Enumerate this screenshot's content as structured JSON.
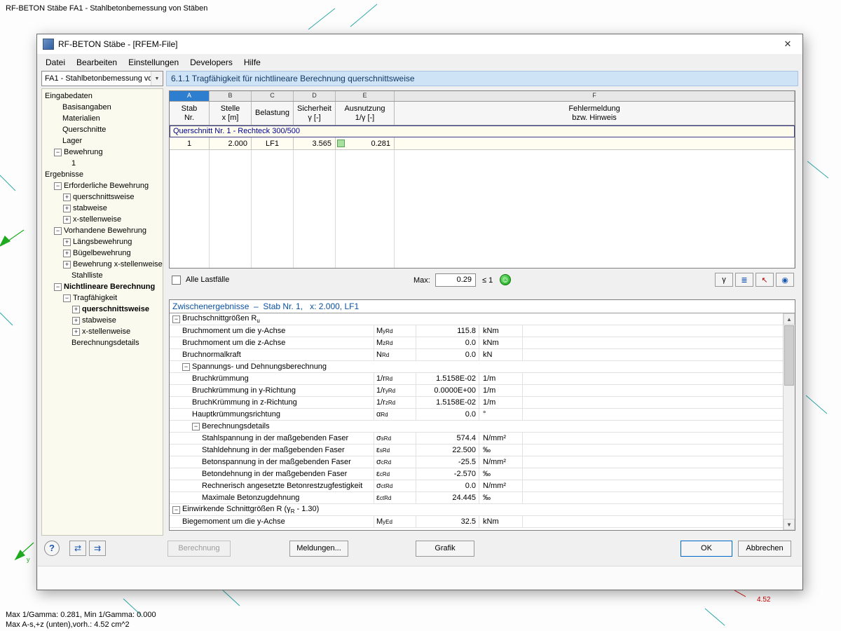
{
  "desktop": {
    "caption": "RF-BETON Stäbe FA1 - Stahlbetonbemessung von Stäben",
    "status1": "Max 1/Gamma: 0.281, Min 1/Gamma: 0.000",
    "status2": "Max A-s,+z (unten),vorh.: 4.52 cm^2",
    "annotation": "4.52",
    "axis_label": "y"
  },
  "dialog": {
    "title": "RF-BETON Stäbe - [RFEM-File]",
    "menu": [
      "Datei",
      "Bearbeiten",
      "Einstellungen",
      "Developers",
      "Hilfe"
    ],
    "nav_selector": "FA1 - Stahlbetonbemessung vo",
    "header": "6.1.1 Tragfähigkeit für nichtlineare Berechnung querschnittsweise"
  },
  "tree": {
    "items": [
      {
        "label": "Eingabedaten",
        "level": 0,
        "exp": "none"
      },
      {
        "label": "Basisangaben",
        "level": 1,
        "exp": "none"
      },
      {
        "label": "Materialien",
        "level": 1,
        "exp": "none"
      },
      {
        "label": "Querschnitte",
        "level": 1,
        "exp": "none"
      },
      {
        "label": "Lager",
        "level": 1,
        "exp": "none"
      },
      {
        "label": "Bewehrung",
        "level": 1,
        "exp": "minus"
      },
      {
        "label": "1",
        "level": 2,
        "exp": "none"
      },
      {
        "label": "Ergebnisse",
        "level": 0,
        "exp": "none"
      },
      {
        "label": "Erforderliche Bewehrung",
        "level": 1,
        "exp": "minus"
      },
      {
        "label": "querschnittsweise",
        "level": 2,
        "exp": "plus"
      },
      {
        "label": "stabweise",
        "level": 2,
        "exp": "plus"
      },
      {
        "label": "x-stellenweise",
        "level": 2,
        "exp": "plus"
      },
      {
        "label": "Vorhandene Bewehrung",
        "level": 1,
        "exp": "minus"
      },
      {
        "label": "Längsbewehrung",
        "level": 2,
        "exp": "plus"
      },
      {
        "label": "Bügelbewehrung",
        "level": 2,
        "exp": "plus"
      },
      {
        "label": "Bewehrung x-stellenweise",
        "level": 2,
        "exp": "plus"
      },
      {
        "label": "Stahlliste",
        "level": 2,
        "exp": "none"
      },
      {
        "label": "Nichtlineare Berechnung",
        "level": 1,
        "exp": "minus",
        "bold": true
      },
      {
        "label": "Tragfähigkeit",
        "level": 2,
        "exp": "minus"
      },
      {
        "label": "querschnittsweise",
        "level": 3,
        "exp": "plus",
        "bold": true,
        "selected": true
      },
      {
        "label": "stabweise",
        "level": 3,
        "exp": "plus"
      },
      {
        "label": "x-stellenweise",
        "level": 3,
        "exp": "plus"
      },
      {
        "label": "Berechnungsdetails",
        "level": 2,
        "exp": "none"
      }
    ]
  },
  "table": {
    "letters": [
      "A",
      "B",
      "C",
      "D",
      "E",
      "F"
    ],
    "selected_letter": "A",
    "headers": [
      {
        "l1": "Stab",
        "l2": "Nr."
      },
      {
        "l1": "Stelle",
        "l2": "x [m]"
      },
      {
        "l1": "Belastung",
        "l2": ""
      },
      {
        "l1": "Sicherheit",
        "l2": "γ [-]"
      },
      {
        "l1": "Ausnutzung",
        "l2": "1/γ [-]"
      },
      {
        "l1": "Fehlermeldung",
        "l2": "bzw. Hinweis"
      }
    ],
    "group_row": "Querschnitt Nr. 1 - Rechteck 300/500",
    "rows": [
      {
        "cells": [
          "1",
          "2.000",
          "LF1",
          "3.565",
          "0.281",
          ""
        ],
        "marker": true
      }
    ]
  },
  "filter": {
    "all_label": "Alle Lastfälle",
    "checked": false,
    "max_label": "Max:",
    "max_value": "0.29",
    "limit": "≤ 1"
  },
  "icons": {
    "close": "✕",
    "dropdown": "▼",
    "scroll_up": "▲",
    "scroll_down": "▼",
    "smiley": "☺",
    "result_toolbar": [
      {
        "name": "filter-gamma-exceeded-icon",
        "glyph": "γ",
        "color": ""
      },
      {
        "name": "result-bars-icon",
        "glyph": "≣",
        "color": "blue"
      },
      {
        "name": "select-in-graphic-icon",
        "glyph": "↖",
        "color": "red"
      },
      {
        "name": "view-mode-icon",
        "glyph": "◉",
        "color": "blue"
      }
    ],
    "footer_tools": [
      {
        "name": "jump-input-icon",
        "glyph": "⇄"
      },
      {
        "name": "jump-output-icon",
        "glyph": "⇉"
      }
    ],
    "help": "?"
  },
  "details": {
    "title": "Zwischenergebnisse  –  Stab Nr. 1,   x: 2.000, LF1",
    "rows": [
      {
        "type": "group",
        "level": 0,
        "label": "Bruchschnittgrößen R_{u}"
      },
      {
        "type": "item",
        "level": 1,
        "label": "Bruchmoment um die y-Achse",
        "sym": "M_{yRd}",
        "value": "115.8",
        "unit": "kNm"
      },
      {
        "type": "item",
        "level": 1,
        "label": "Bruchmoment um die z-Achse",
        "sym": "M_{zRd}",
        "value": "0.0",
        "unit": "kNm"
      },
      {
        "type": "item",
        "level": 1,
        "label": "Bruchnormalkraft",
        "sym": "N_{Rd}",
        "value": "0.0",
        "unit": "kN"
      },
      {
        "type": "group",
        "level": 1,
        "label": "Spannungs- und Dehnungsberechnung"
      },
      {
        "type": "item",
        "level": 2,
        "label": "Bruchkrümmung",
        "sym": "1/r_{Rd}",
        "value": "1.5158E-02",
        "unit": "1/m"
      },
      {
        "type": "item",
        "level": 2,
        "label": "Bruchkrümmung in y-Richtung",
        "sym": "1/r_{yRd}",
        "value": "0.0000E+00",
        "unit": "1/m"
      },
      {
        "type": "item",
        "level": 2,
        "label": "BruchKrümmung in z-Richtung",
        "sym": "1/r_{zRd}",
        "value": "1.5158E-02",
        "unit": "1/m"
      },
      {
        "type": "item",
        "level": 2,
        "label": "Hauptkrümmungsrichtung",
        "sym": "α_{Rd}",
        "value": "0.0",
        "unit": "°"
      },
      {
        "type": "group",
        "level": 2,
        "label": "Berechnungsdetails"
      },
      {
        "type": "item",
        "level": 3,
        "label": "Stahlspannung in der maßgebenden Faser",
        "sym": "σ_{sRd}",
        "value": "574.4",
        "unit": "N/mm²"
      },
      {
        "type": "item",
        "level": 3,
        "label": "Stahldehnung in der maßgebenden Faser",
        "sym": "ε_{sRd}",
        "value": "22.500",
        "unit": "‰"
      },
      {
        "type": "item",
        "level": 3,
        "label": "Betonspannung in der maßgebenden Faser",
        "sym": "σ_{cRd}",
        "value": "-25.5",
        "unit": "N/mm²"
      },
      {
        "type": "item",
        "level": 3,
        "label": "Betondehnung in der maßgebenden Faser",
        "sym": "ε_{cRd}",
        "value": "-2.570",
        "unit": "‰"
      },
      {
        "type": "item",
        "level": 3,
        "label": "Rechnerisch angesetzte Betonrestzugfestigkeit",
        "sym": "σ_{ctRd}",
        "value": "0.0",
        "unit": "N/mm²"
      },
      {
        "type": "item",
        "level": 3,
        "label": "Maximale Betonzugdehnung",
        "sym": "ε_{ctRd}",
        "value": "24.445",
        "unit": "‰"
      },
      {
        "type": "group",
        "level": 0,
        "label": "Einwirkende Schnittgrößen R  (γ_{R} - 1.30)"
      },
      {
        "type": "item",
        "level": 1,
        "label": "Biegemoment um die y-Achse",
        "sym": "M_{yEd}",
        "value": "32.5",
        "unit": "kNm"
      }
    ]
  },
  "footer": {
    "berechnung": "Berechnung",
    "meldungen": "Meldungen...",
    "grafik": "Grafik",
    "ok": "OK",
    "abbrechen": "Abbrechen"
  }
}
